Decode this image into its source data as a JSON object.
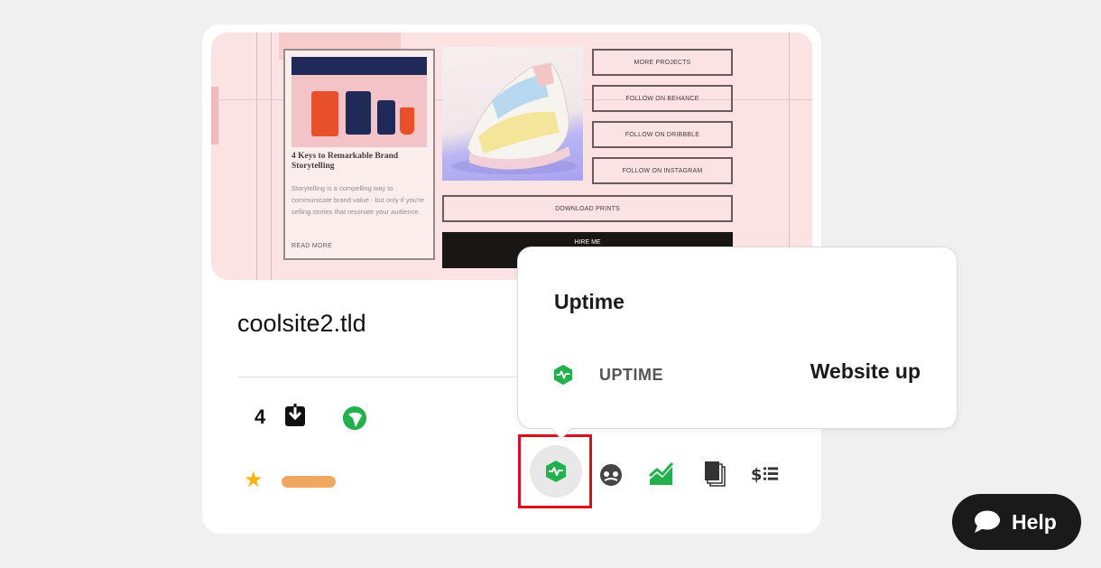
{
  "site": {
    "name": "coolsite2.tld",
    "update_count": "4",
    "preview": {
      "blog_title": "4 Keys to Remarkable Brand Storytelling",
      "blog_body": "Storytelling is a compelling way to communicate brand value - but only if you're selling stories that resonate your audience.",
      "read_more": "READ MORE",
      "buttons": [
        "MORE PROJECTS",
        "FOLLOW ON BEHANCE",
        "FOLLOW ON DRIBBBLE",
        "FOLLOW ON INSTAGRAM"
      ],
      "download": "DOWNLOAD PRINTS",
      "hire": "HIRE ME"
    }
  },
  "popover": {
    "title": "Uptime",
    "label": "UPTIME",
    "status": "Website up"
  },
  "help": {
    "label": "Help"
  },
  "colors": {
    "accent_green": "#22b14c",
    "highlight_red": "#e00b1c",
    "star": "#f5b40f",
    "tag": "#f0a860"
  }
}
